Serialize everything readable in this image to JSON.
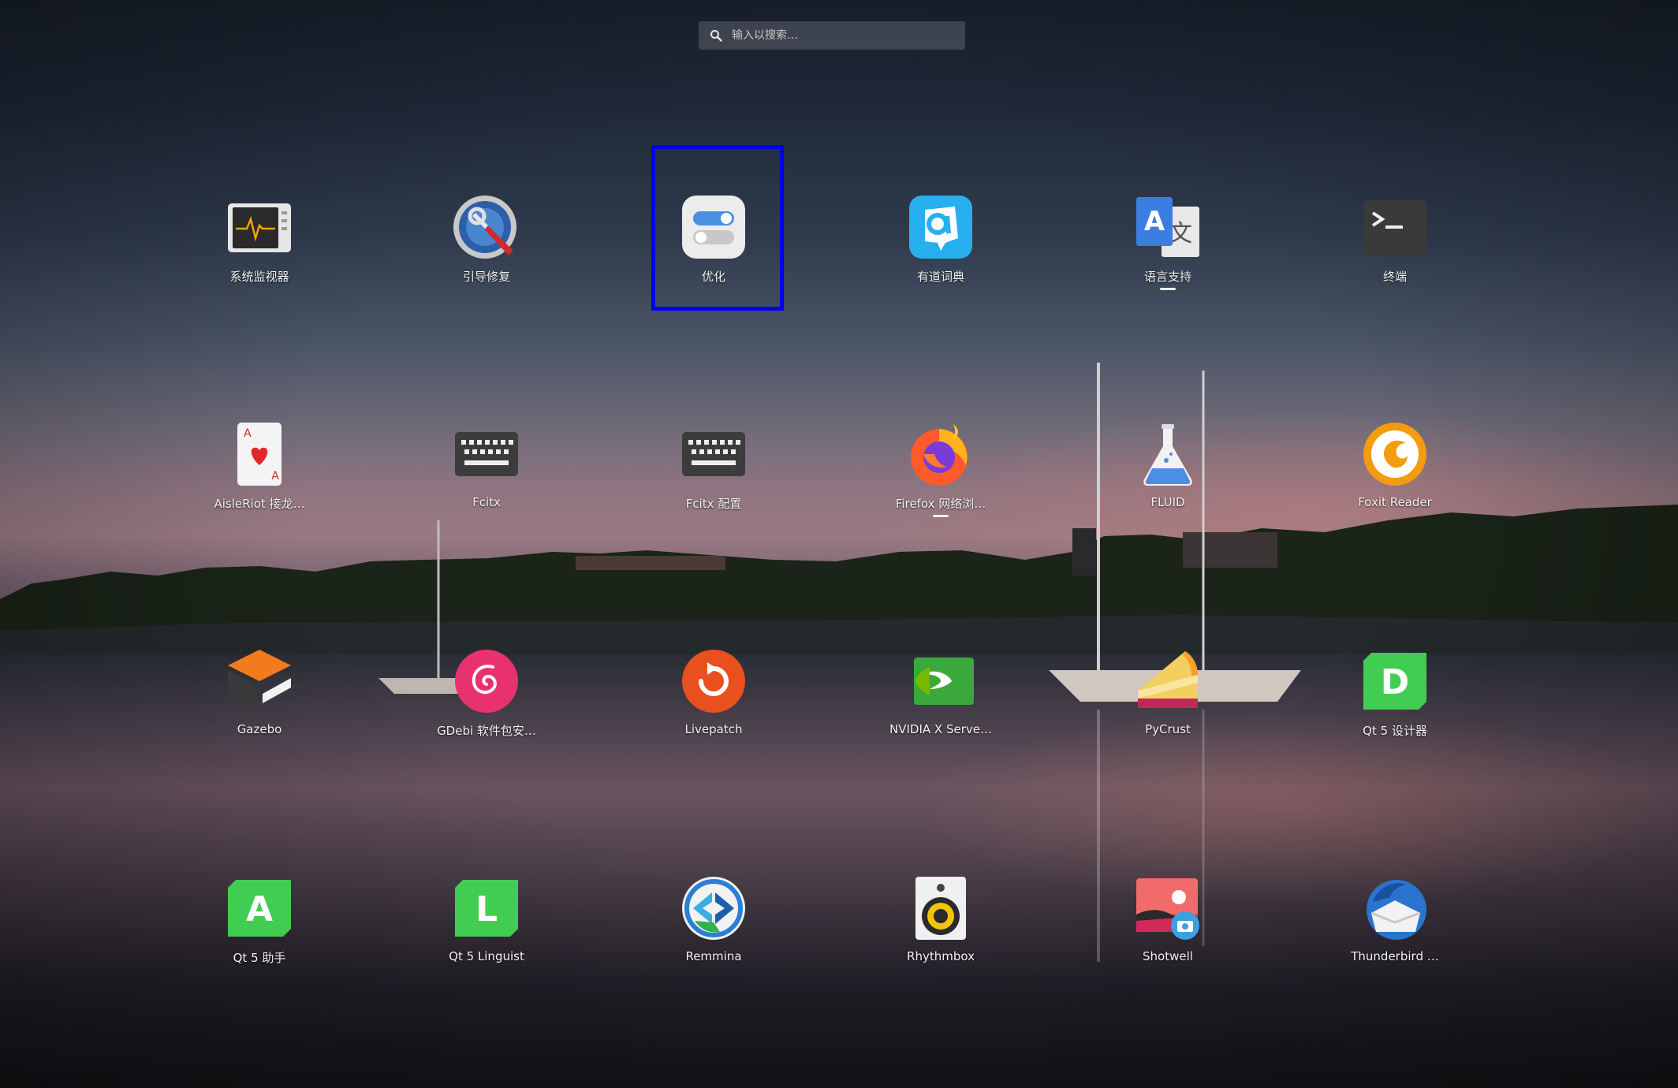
{
  "search": {
    "placeholder": "输入以搜索…"
  },
  "apps": [
    {
      "id": "system-monitor",
      "label": "系统监视器",
      "icon": "system-monitor-icon",
      "running": false
    },
    {
      "id": "boot-repair",
      "label": "引导修复",
      "icon": "boot-repair-icon",
      "running": false
    },
    {
      "id": "tweaks",
      "label": "优化",
      "icon": "tweaks-icon",
      "running": false,
      "selected": true
    },
    {
      "id": "youdao-dict",
      "label": "有道词典",
      "icon": "youdao-dict-icon",
      "running": false
    },
    {
      "id": "language-support",
      "label": "语言支持",
      "icon": "language-support-icon",
      "running": true
    },
    {
      "id": "terminal",
      "label": "终端",
      "icon": "terminal-icon",
      "running": false
    },
    {
      "id": "aisleriot",
      "label": "AisleRiot 接龙…",
      "icon": "playing-card-icon",
      "running": false
    },
    {
      "id": "fcitx",
      "label": "Fcitx",
      "icon": "keyboard-icon",
      "running": false
    },
    {
      "id": "fcitx-config",
      "label": "Fcitx 配置",
      "icon": "keyboard-icon",
      "running": false
    },
    {
      "id": "firefox",
      "label": "Firefox 网络浏…",
      "icon": "firefox-icon",
      "running": true
    },
    {
      "id": "fluid",
      "label": "FLUID",
      "icon": "flask-icon",
      "running": false
    },
    {
      "id": "foxit-reader",
      "label": "Foxit Reader",
      "icon": "foxit-reader-icon",
      "running": false
    },
    {
      "id": "gazebo",
      "label": "Gazebo",
      "icon": "gazebo-icon",
      "running": false
    },
    {
      "id": "gdebi",
      "label": "GDebi 软件包安…",
      "icon": "debian-swirl-icon",
      "running": false
    },
    {
      "id": "livepatch",
      "label": "Livepatch",
      "icon": "livepatch-icon",
      "running": false
    },
    {
      "id": "nvidia-settings",
      "label": "NVIDIA X Serve…",
      "icon": "nvidia-icon",
      "running": false
    },
    {
      "id": "pycrust",
      "label": "PyCrust",
      "icon": "pie-slice-icon",
      "running": false
    },
    {
      "id": "qt5-designer",
      "label": "Qt 5 设计器",
      "icon": "qt-designer-icon",
      "running": false
    },
    {
      "id": "qt5-assistant",
      "label": "Qt 5 助手",
      "icon": "qt-assistant-icon",
      "running": false
    },
    {
      "id": "qt5-linguist",
      "label": "Qt 5 Linguist",
      "icon": "qt-linguist-icon",
      "running": false
    },
    {
      "id": "remmina",
      "label": "Remmina",
      "icon": "remmina-icon",
      "running": false
    },
    {
      "id": "rhythmbox",
      "label": "Rhythmbox",
      "icon": "speaker-icon",
      "running": false
    },
    {
      "id": "shotwell",
      "label": "Shotwell",
      "icon": "photo-camera-icon",
      "running": false
    },
    {
      "id": "thunderbird",
      "label": "Thunderbird …",
      "icon": "thunderbird-icon",
      "running": false
    }
  ],
  "colors": {
    "selection_border": "#0000ee",
    "qt_green": "#41cd52",
    "foxit_orange": "#f39c12",
    "gdebi_pink": "#e8326e"
  }
}
